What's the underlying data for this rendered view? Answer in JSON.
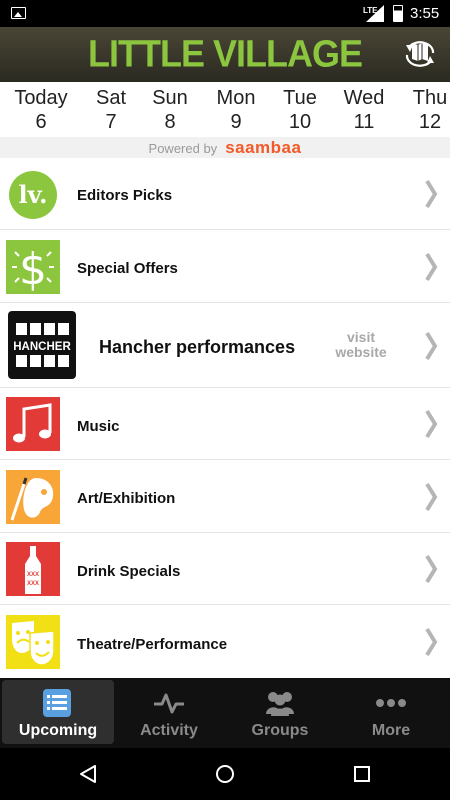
{
  "status_bar": {
    "network": "LTE",
    "time": "3:55"
  },
  "header": {
    "title": "LITTLE VILLAGE"
  },
  "dates": [
    {
      "day": "Today",
      "num": "6"
    },
    {
      "day": "Sat",
      "num": "7"
    },
    {
      "day": "Sun",
      "num": "8"
    },
    {
      "day": "Mon",
      "num": "9"
    },
    {
      "day": "Tue",
      "num": "10"
    },
    {
      "day": "Wed",
      "num": "11"
    },
    {
      "day": "Thu",
      "num": "12"
    }
  ],
  "powered": {
    "prefix": "Powered by",
    "brand": "saambaa"
  },
  "categories": [
    {
      "label": "Editors Picks",
      "icon": "lv-logo-icon",
      "color": "#8cc63f",
      "icon_text": "lv."
    },
    {
      "label": "Special Offers",
      "icon": "dollar-icon",
      "color": "#8cc63f",
      "icon_text": "$"
    },
    {
      "label": "Hancher performances",
      "icon": "hancher-logo-icon",
      "color": "#111111",
      "icon_text": "HANCHER",
      "link": "visit website"
    },
    {
      "label": "Music",
      "icon": "music-note-icon",
      "color": "#e23b37"
    },
    {
      "label": "Art/Exhibition",
      "icon": "palette-icon",
      "color": "#f7a637"
    },
    {
      "label": "Drink Specials",
      "icon": "bottle-icon",
      "color": "#e23b37",
      "icon_text": "XXX"
    },
    {
      "label": "Theatre/Performance",
      "icon": "theatre-masks-icon",
      "color": "#f2e016"
    }
  ],
  "tabs": [
    {
      "label": "Upcoming",
      "icon": "list-icon",
      "active": true
    },
    {
      "label": "Activity",
      "icon": "pulse-icon",
      "active": false
    },
    {
      "label": "Groups",
      "icon": "people-icon",
      "active": false
    },
    {
      "label": "More",
      "icon": "dots-icon",
      "active": false
    }
  ],
  "nav": {
    "back": "back-icon",
    "home": "home-icon",
    "recents": "recents-icon"
  }
}
